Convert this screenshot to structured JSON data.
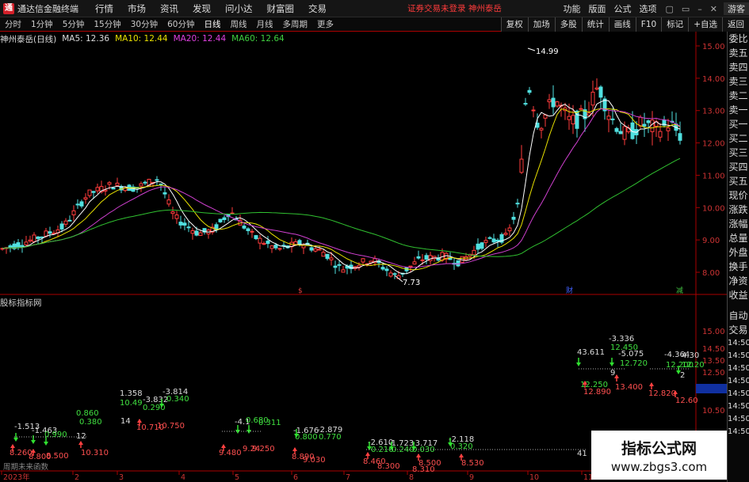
{
  "title": {
    "logo": "通",
    "app": "通达信金融终端"
  },
  "menu": [
    "行情",
    "市场",
    "资讯",
    "发现",
    "问小达",
    "财富圈",
    "交易"
  ],
  "center_msg": "证券交易未登录   神州泰岳",
  "right_menu": [
    "功能",
    "版面",
    "公式",
    "选项"
  ],
  "win_buttons": [
    "▢",
    "▭",
    "–",
    "✕"
  ],
  "guest": "游客",
  "tabs": [
    "分时",
    "1分钟",
    "5分钟",
    "15分钟",
    "30分钟",
    "60分钟",
    "日线",
    "周线",
    "月线",
    "多周期",
    "更多"
  ],
  "right_tools": [
    "复权",
    "加场",
    "多股",
    "统计",
    "画线",
    "F10",
    "标记",
    "+自选",
    "返回"
  ],
  "main_info": {
    "name": "神州泰岳(日线)",
    "ma5": "MA5: 12.36",
    "ma10": "MA10: 12.44",
    "ma20": "MA20: 12.44",
    "ma60": "MA60: 12.64"
  },
  "sub_info": "股标指标网",
  "price_axis": [
    "15.00",
    "14.00",
    "13.00",
    "12.00",
    "11.00",
    "10.00",
    "9.00",
    "8.00"
  ],
  "sub_axis": [
    "15.00",
    "14.50",
    "13.50",
    "12.50",
    "11.48",
    "10.50"
  ],
  "sidebar": [
    "委比",
    "卖五",
    "卖四",
    "卖三",
    "卖二",
    "卖一",
    "买一",
    "买二",
    "买三",
    "买四",
    "买五",
    "现价",
    "涨跌",
    "涨幅",
    "总量",
    "外盘",
    "换手",
    "净资",
    "收益",
    "",
    "自动",
    "交易",
    "14:50",
    "14:50",
    "14:50",
    "14:50",
    "14:50",
    "14:50",
    "14:50",
    "14:50"
  ],
  "annotations": {
    "high": "14.99",
    "low": "7.73"
  },
  "flags": [
    "$",
    "财",
    "减"
  ],
  "sub_labels": [
    "-1.513",
    "-1.463",
    "0.990",
    "8.260",
    "8.800",
    "8.500",
    "12",
    "10.310",
    "0.860",
    "0.380",
    "1.358",
    "10.49",
    "-3.832",
    "0.290",
    "-3.814",
    "0.340",
    "14",
    "10.710",
    "10.750",
    "-4.1",
    "0.680",
    "0.311",
    "9.480",
    "9.24",
    "9.250",
    "-1.676",
    "-2.879",
    "0.800",
    "0.770",
    "8.890",
    "9.030",
    "-2.610",
    "-1.723",
    "-3.717",
    "-2.118",
    "0.210",
    "0.240",
    "0.030",
    "0.320",
    "8.460",
    "8.300",
    "8.500",
    "8.530",
    "8.310",
    "41",
    "43.611",
    "12.250",
    "-3.336",
    "12.450",
    "-5.075",
    "12.720",
    "12.890",
    "13.400",
    "9",
    "-4.364",
    "4.30",
    "12.200",
    "12.20",
    "12.820",
    "12.60",
    "2"
  ],
  "x_axis": [
    "2023年",
    "2",
    "3",
    "4",
    "5",
    "6",
    "7",
    "8",
    "9",
    "10",
    "11"
  ],
  "footer": "周期未来函数",
  "watermark": {
    "line1": "指标公式网",
    "line2": "www.zbgs3.com"
  }
}
